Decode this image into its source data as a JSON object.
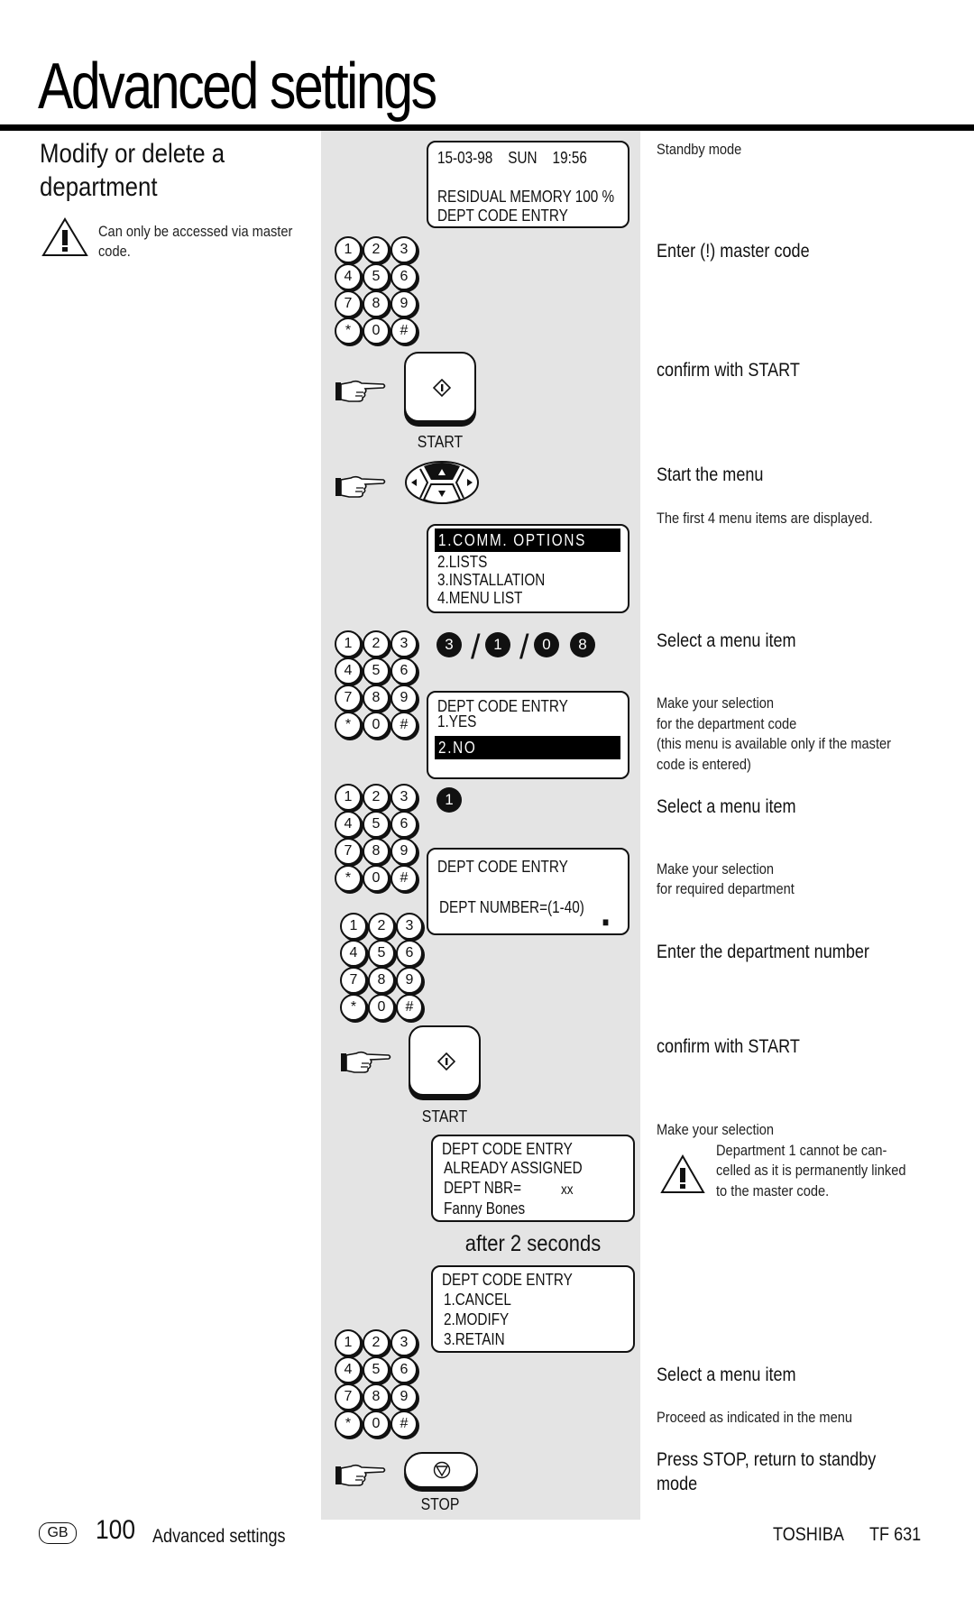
{
  "page": {
    "title": "Advanced settings",
    "section_heading": "Modify or delete a department",
    "access_note": "Can only be accessed via master code."
  },
  "displays": {
    "standby": {
      "line1": "15-03-98    SUN    19:56",
      "line2": "RESIDUAL MEMORY 100 %",
      "line3": "DEPT CODE ENTRY"
    },
    "main_menu": {
      "items": [
        "1.COMM. OPTIONS",
        "2.LISTS",
        "3.INSTALLATION",
        "4.MENU LIST"
      ],
      "selected_index": 0
    },
    "dept_code_yesno": {
      "title": "DEPT CODE ENTRY",
      "options": [
        "1.YES",
        "2.NO"
      ],
      "selected_index": 1
    },
    "dept_number": {
      "title": "DEPT CODE ENTRY",
      "prompt": "DEPT NUMBER=(1-40)",
      "cursor": "■"
    },
    "already_assigned": {
      "line1": "DEPT CODE ENTRY",
      "line2": "ALREADY ASSIGNED",
      "line3_label": "DEPT NBR=",
      "line3_value": "xx",
      "line4": "Fanny Bones"
    },
    "modify_menu": {
      "title": "DEPT CODE ENTRY",
      "options": [
        "1.CANCEL",
        "2.MODIFY",
        "3.RETAIN"
      ]
    }
  },
  "keypad": {
    "keys": [
      "1",
      "2",
      "3",
      "4",
      "5",
      "6",
      "7",
      "8",
      "9",
      "*",
      "0",
      "#"
    ]
  },
  "key_sequence_1": [
    "3",
    "/",
    "1",
    "/",
    "0",
    "8"
  ],
  "key_sequence_2": [
    "1"
  ],
  "buttons": {
    "start_label": "START",
    "stop_label": "STOP"
  },
  "delay_label": "after 2 seconds",
  "steps": {
    "standby": "Standby mode",
    "enter_master": "Enter (!) master code",
    "confirm_start_1": "confirm with START",
    "start_menu": "Start the menu",
    "first_items": "The first 4 menu items are displayed.",
    "select_item_1": "Select a menu item",
    "make_selection_dept_code": [
      "Make your selection",
      "for the department code",
      "(this menu is available only if the master",
      "code is entered)"
    ],
    "select_item_2": "Select a menu item",
    "make_selection_required": [
      "Make your selection",
      "for required department"
    ],
    "enter_dept_number": "Enter the department number",
    "confirm_start_2": "confirm with START",
    "make_selection_3": "Make your selection",
    "warning_dept1": [
      "Department 1 cannot be can-",
      "celled as it is permanently linked",
      "to the master code."
    ],
    "select_item_3": "Select a menu item",
    "proceed": "Proceed as indicated in the menu",
    "press_stop": [
      "Press STOP, return to standby",
      "mode"
    ]
  },
  "footer": {
    "lang_badge": "GB",
    "page_number": "100",
    "section": "Advanced settings",
    "brand": "TOSHIBA",
    "model": "TF 631"
  }
}
